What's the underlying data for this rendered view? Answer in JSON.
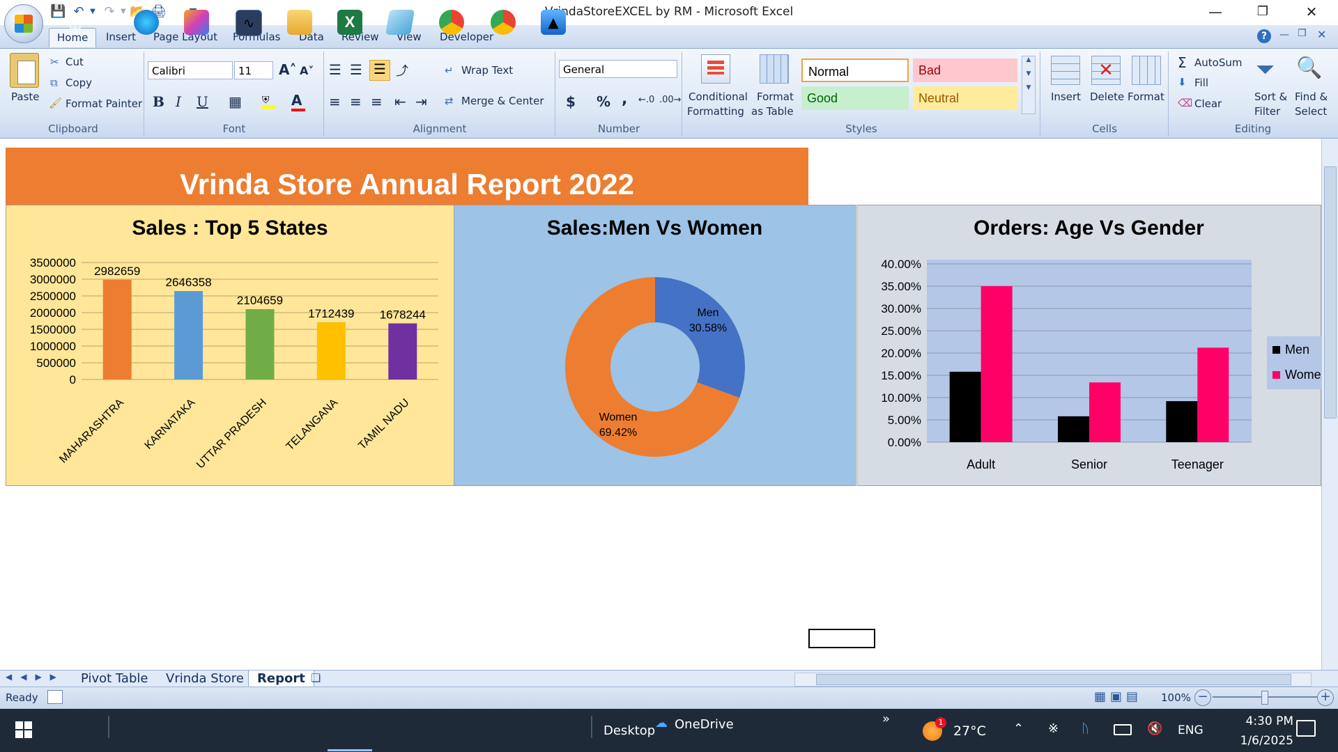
{
  "window": {
    "title": "VrindaStoreEXCEL by RM - Microsoft Excel"
  },
  "ribbon": {
    "tabs": [
      "Home",
      "Insert",
      "Page Layout",
      "Formulas",
      "Data",
      "Review",
      "View",
      "Developer"
    ],
    "clipboard": {
      "paste": "Paste",
      "cut": "Cut",
      "copy": "Copy",
      "format_painter": "Format Painter",
      "label": "Clipboard"
    },
    "font": {
      "name": "Calibri",
      "size": "11",
      "bold": "B",
      "italic": "I",
      "underline": "U",
      "label": "Font"
    },
    "alignment": {
      "wrap_text": "Wrap Text",
      "merge_center": "Merge & Center",
      "label": "Alignment"
    },
    "number": {
      "format": "General",
      "currency": "$",
      "percent": "%",
      "comma": ",",
      "label": "Number"
    },
    "styles": {
      "conditional": "Conditional",
      "conditional2": "Formatting",
      "format_table": "Format",
      "format_table2": "as Table",
      "normal": "Normal",
      "bad": "Bad",
      "good": "Good",
      "neutral": "Neutral",
      "label": "Styles"
    },
    "cells": {
      "insert": "Insert",
      "delete": "Delete",
      "format": "Format",
      "label": "Cells"
    },
    "editing": {
      "autosum": "AutoSum",
      "fill": "Fill",
      "clear": "Clear",
      "sort": "Sort &",
      "sort2": "Filter",
      "find": "Find &",
      "find2": "Select",
      "label": "Editing"
    }
  },
  "report": {
    "title": "Vrinda Store Annual Report 2022",
    "colors": {
      "title_bg": "#ed7d31",
      "panel1_bg": "#ffe699",
      "panel2_bg": "#9dc3e6",
      "panel3_bg": "#d6dce4"
    }
  },
  "chart_data": [
    {
      "type": "bar",
      "title": "Sales : Top 5 States",
      "categories": [
        "MAHARASHTRA",
        "KARNATAKA",
        "UTTAR PRADESH",
        "TELANGANA",
        "TAMIL NADU"
      ],
      "values": [
        2982659,
        2646358,
        2104659,
        1712439,
        1678244
      ],
      "colors": [
        "#ed7d31",
        "#5b9bd5",
        "#70ad47",
        "#ffc000",
        "#7030a0"
      ],
      "ylim": [
        0,
        3500000
      ],
      "yticks": [
        "0",
        "500000",
        "1000000",
        "1500000",
        "2000000",
        "2500000",
        "3000000",
        "3500000"
      ],
      "grid": true
    },
    {
      "type": "pie",
      "title": "Sales:Men Vs Women",
      "labels": [
        "Men",
        "Women"
      ],
      "value_labels": [
        "30.58%",
        "69.42%"
      ],
      "values": [
        30.58,
        69.42
      ],
      "colors": [
        "#4472c4",
        "#ed7d31"
      ],
      "donut": true
    },
    {
      "type": "bar",
      "title": "Orders: Age Vs Gender",
      "categories": [
        "Adult",
        "Senior",
        "Teenager"
      ],
      "series": [
        {
          "name": "Men",
          "values": [
            15.8,
            5.8,
            9.2
          ],
          "color": "#000000"
        },
        {
          "name": "Women",
          "values": [
            35.0,
            13.4,
            21.2
          ],
          "color": "#ff0066"
        }
      ],
      "ylim": [
        0,
        40
      ],
      "yticks": [
        "0.00%",
        "5.00%",
        "10.00%",
        "15.00%",
        "20.00%",
        "25.00%",
        "30.00%",
        "35.00%",
        "40.00%"
      ],
      "legend_visible": [
        "Men",
        "Wome"
      ],
      "legend": "right",
      "grid": true
    }
  ],
  "sheets": {
    "tabs": [
      "Pivot Table",
      "Vrinda Store",
      "Report"
    ],
    "active": "Report"
  },
  "status": {
    "ready": "Ready",
    "zoom": "100%"
  },
  "taskbar": {
    "desktop": "Desktop",
    "onedrive": "OneDrive",
    "weather": "27°C",
    "lang": "ENG",
    "time": "4:30 PM",
    "date": "1/6/2025",
    "badge": "1"
  }
}
